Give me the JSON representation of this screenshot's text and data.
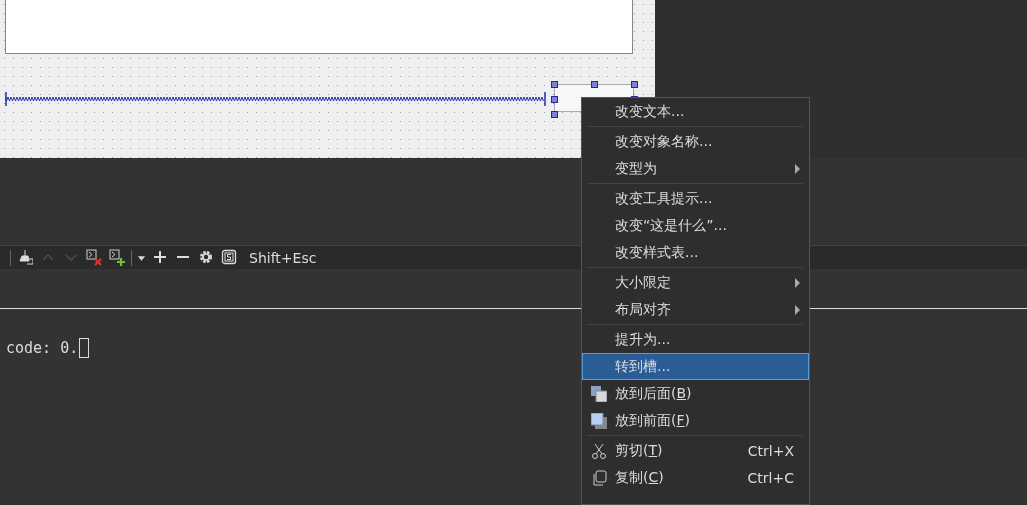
{
  "form": {
    "button": {
      "selected": true
    }
  },
  "toolbar": {
    "buttons": [
      {
        "kind": "clear",
        "disabled": false
      },
      {
        "kind": "up",
        "disabled": true
      },
      {
        "kind": "down",
        "disabled": true
      },
      {
        "kind": "close-console",
        "disabled": false
      },
      {
        "kind": "add-console",
        "disabled": false
      },
      {
        "kind": "dropdown",
        "disabled": false
      },
      {
        "kind": "plus",
        "disabled": false
      },
      {
        "kind": "minus",
        "disabled": false
      },
      {
        "kind": "settings",
        "disabled": false
      },
      {
        "kind": "stop",
        "disabled": false
      }
    ],
    "shortcut": "Shift+Esc"
  },
  "console": {
    "text": "code: 0."
  },
  "context_menu": {
    "items": [
      {
        "kind": "item",
        "label": [
          "改变文本..."
        ],
        "submenu": false,
        "selected": false,
        "disabled": false
      },
      {
        "kind": "separator"
      },
      {
        "kind": "item",
        "label": [
          "改变对象名称..."
        ],
        "submenu": false,
        "selected": false,
        "disabled": false
      },
      {
        "kind": "item",
        "label": [
          "变型为"
        ],
        "submenu": true,
        "selected": false,
        "disabled": false
      },
      {
        "kind": "separator"
      },
      {
        "kind": "item",
        "label": [
          "改变工具提示..."
        ],
        "submenu": false,
        "selected": false,
        "disabled": false
      },
      {
        "kind": "item",
        "label": [
          "改变“这是什么”..."
        ],
        "submenu": false,
        "selected": false,
        "disabled": false
      },
      {
        "kind": "item",
        "label": [
          "改变样式表..."
        ],
        "submenu": false,
        "selected": false,
        "disabled": false
      },
      {
        "kind": "separator"
      },
      {
        "kind": "item",
        "label": [
          "大小限定"
        ],
        "submenu": true,
        "selected": false,
        "disabled": false
      },
      {
        "kind": "item",
        "label": [
          "布局对齐"
        ],
        "submenu": true,
        "selected": false,
        "disabled": false
      },
      {
        "kind": "separator"
      },
      {
        "kind": "item",
        "label": [
          "提升为..."
        ],
        "submenu": false,
        "selected": false,
        "disabled": false
      },
      {
        "kind": "item",
        "label": [
          "转到槽..."
        ],
        "submenu": false,
        "selected": true,
        "disabled": false
      },
      {
        "kind": "back",
        "label": [
          "放到后面(",
          "B",
          ")"
        ],
        "submenu": false,
        "selected": false,
        "disabled": false
      },
      {
        "kind": "front",
        "label": [
          "放到前面(",
          "F",
          ")"
        ],
        "submenu": false,
        "selected": false,
        "disabled": false
      },
      {
        "kind": "separator"
      },
      {
        "kind": "cut",
        "label": [
          "剪切(",
          "T",
          ")"
        ],
        "shortcut": "Ctrl+X",
        "submenu": false,
        "selected": false,
        "disabled": false
      },
      {
        "kind": "copy",
        "label": [
          "复制(",
          "C",
          ")"
        ],
        "shortcut": "Ctrl+C",
        "submenu": false,
        "selected": false,
        "disabled": false
      }
    ]
  }
}
